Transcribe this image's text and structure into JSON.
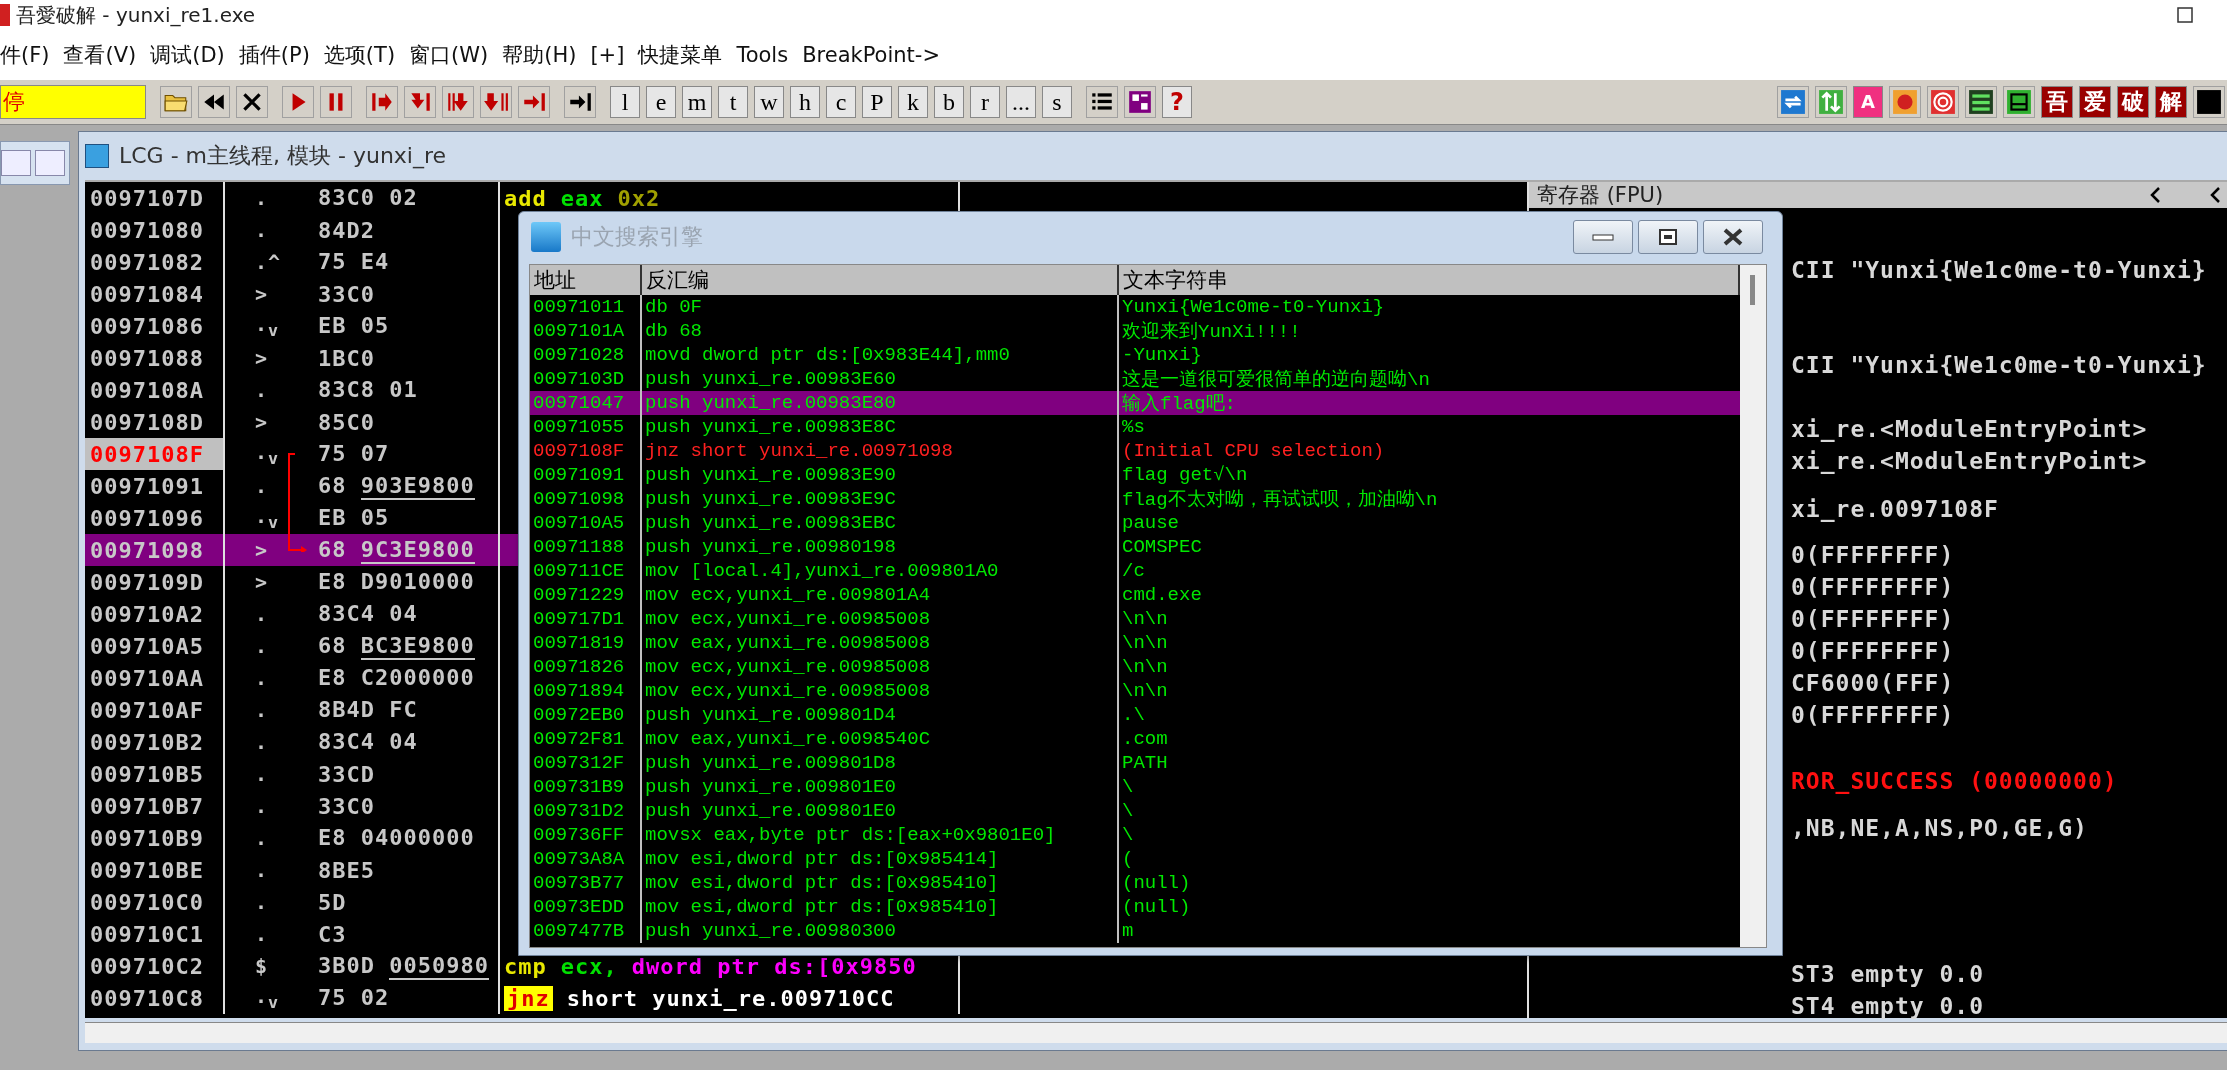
{
  "title_bar": {
    "title": "吾愛破解 - yunxi_re1.exe"
  },
  "menu": [
    "件(F)",
    "查看(V)",
    "调试(D)",
    "插件(P)",
    "选项(T)",
    "窗口(W)",
    "帮助(H)",
    "[+]",
    "快捷菜单",
    "Tools",
    "BreakPoint->"
  ],
  "toolbar": {
    "status": "停",
    "groups": [
      [
        {
          "kind": "open"
        },
        {
          "kind": "rewind"
        },
        {
          "kind": "close"
        }
      ],
      [
        {
          "kind": "run"
        },
        {
          "kind": "pause"
        }
      ],
      [
        {
          "kind": "step-into"
        },
        {
          "kind": "step-over"
        },
        {
          "kind": "trace-into"
        },
        {
          "kind": "trace-over"
        },
        {
          "kind": "till-return"
        }
      ],
      [
        {
          "kind": "goto"
        }
      ],
      [
        {
          "kind": "letter",
          "label": "l"
        },
        {
          "kind": "letter",
          "label": "e"
        },
        {
          "kind": "letter",
          "label": "m"
        },
        {
          "kind": "letter",
          "label": "t"
        },
        {
          "kind": "letter",
          "label": "w"
        },
        {
          "kind": "letter",
          "label": "h"
        },
        {
          "kind": "letter",
          "label": "c"
        },
        {
          "kind": "letter",
          "label": "P"
        },
        {
          "kind": "letter",
          "label": "k"
        },
        {
          "kind": "letter",
          "label": "b"
        },
        {
          "kind": "letter",
          "label": "r"
        },
        {
          "kind": "letter",
          "label": "..."
        },
        {
          "kind": "letter",
          "label": "s"
        }
      ],
      [
        {
          "kind": "list"
        },
        {
          "kind": "windows"
        },
        {
          "kind": "help",
          "label": "?"
        }
      ],
      [
        {
          "kind": "refresh"
        },
        {
          "kind": "swap"
        },
        {
          "kind": "tag-pink",
          "label": "A"
        },
        {
          "kind": "record"
        },
        {
          "kind": "target"
        },
        {
          "kind": "binary"
        },
        {
          "kind": "panel"
        },
        {
          "kind": "tag-red",
          "label": "吾"
        },
        {
          "kind": "tag-red",
          "label": "爱"
        },
        {
          "kind": "tag-red",
          "label": "破"
        },
        {
          "kind": "tag-red",
          "label": "解"
        },
        {
          "kind": "black"
        }
      ]
    ]
  },
  "cpu_window": {
    "title": "LCG - m主线程, 模块 - yunxi_re",
    "rows": [
      {
        "address": "0097107D",
        "flag": ".",
        "opcode": "83C0",
        "operand": "02",
        "underlined": false,
        "current": false,
        "selected": false,
        "asm": [
          {
            "text": "add",
            "kind": "cmd"
          },
          {
            "text": "eax",
            "kind": "reg"
          },
          {
            "text": "0x2",
            "kind": "num"
          }
        ]
      },
      {
        "address": "00971080",
        "flag": ".",
        "opcode": "84D2",
        "current": false,
        "selected": false
      },
      {
        "address": "00971082",
        "flag": ".^",
        "opcode": "75",
        "operand": "E4",
        "underlined": false,
        "current": false,
        "selected": false
      },
      {
        "address": "00971084",
        "flag": ">",
        "opcode": "33C0",
        "current": false,
        "selected": false
      },
      {
        "address": "00971086",
        "flag": ".$_{v}$",
        "opcode": "EB",
        "operand": "05",
        "underlined": false,
        "current": false,
        "selected": false
      },
      {
        "address": "00971088",
        "flag": ">",
        "opcode": "1BC0",
        "current": false,
        "selected": false
      },
      {
        "address": "0097108A",
        "flag": ".",
        "opcode": "83C8",
        "operand": "01",
        "underlined": false,
        "current": false,
        "selected": false
      },
      {
        "address": "0097108D",
        "flag": ">",
        "opcode": "85C0",
        "current": false,
        "selected": false
      },
      {
        "address": "0097108F",
        "flag": ".$_{v}$",
        "opcode": "75",
        "operand": "07",
        "underlined": false,
        "current": true,
        "selected": false,
        "jump_start": true
      },
      {
        "address": "00971091",
        "flag": ".",
        "opcode": "68",
        "operand": "903E9800",
        "underlined": true,
        "current": false,
        "selected": false
      },
      {
        "address": "00971096",
        "flag": ".$_{v}$",
        "opcode": "EB",
        "operand": "05",
        "underlined": false,
        "current": false,
        "selected": false
      },
      {
        "address": "00971098",
        "flag": ">",
        "opcode": "68",
        "operand": "9C3E9800",
        "underlined": true,
        "current": false,
        "selected": true,
        "jump_end": true
      },
      {
        "address": "0097109D",
        "flag": ">",
        "opcode": "E8",
        "operand": "D9010000",
        "underlined": false,
        "current": false,
        "selected": false
      },
      {
        "address": "009710A2",
        "flag": ".",
        "opcode": "83C4",
        "operand": "04",
        "underlined": false,
        "current": false,
        "selected": false
      },
      {
        "address": "009710A5",
        "flag": ".",
        "opcode": "68",
        "operand": "BC3E9800",
        "underlined": true,
        "current": false,
        "selected": false
      },
      {
        "address": "009710AA",
        "flag": ".",
        "opcode": "E8",
        "operand": "C2000000",
        "underlined": false,
        "current": false,
        "selected": false
      },
      {
        "address": "009710AF",
        "flag": ".",
        "opcode": "8B4D",
        "operand": "FC",
        "underlined": false,
        "current": false,
        "selected": false
      },
      {
        "address": "009710B2",
        "flag": ".",
        "opcode": "83C4",
        "operand": "04",
        "underlined": false,
        "current": false,
        "selected": false
      },
      {
        "address": "009710B5",
        "flag": ".",
        "opcode": "33CD",
        "current": false,
        "selected": false
      },
      {
        "address": "009710B7",
        "flag": ".",
        "opcode": "33C0",
        "current": false,
        "selected": false
      },
      {
        "address": "009710B9",
        "flag": ".",
        "opcode": "E8",
        "operand": "04000000",
        "underlined": false,
        "current": false,
        "selected": false
      },
      {
        "address": "009710BE",
        "flag": ".",
        "opcode": "8BE5",
        "current": false,
        "selected": false
      },
      {
        "address": "009710C0",
        "flag": ".",
        "opcode": "5D",
        "current": false,
        "selected": false
      },
      {
        "address": "009710C1",
        "flag": ".",
        "opcode": "C3",
        "current": false,
        "selected": false
      },
      {
        "address": "009710C2",
        "flag": "$",
        "opcode": "3B0D",
        "operand": "0050980",
        "underlined": true,
        "current": false,
        "selected": false,
        "asm": [
          {
            "text": "cmp",
            "kind": "cmd"
          },
          {
            "text": "ecx,",
            "kind": "reg"
          },
          {
            "text": "dword ptr ds:[0x9850",
            "kind": "mem"
          }
        ]
      },
      {
        "address": "009710C8",
        "flag": ".$_{v}$",
        "opcode": "75",
        "operand": "02",
        "underlined": false,
        "current": false,
        "selected": false,
        "asm": [
          {
            "text": "jnz",
            "kind": "jcc"
          },
          {
            "text": "short yunxi_re.009710CC",
            "kind": "plain"
          }
        ]
      }
    ],
    "registers": {
      "title": "寄存器 (FPU)",
      "groups": [
        [
          {
            "text": "CII \"Yunxi{We1c0me-t0-Yunxi}",
            "kind": "normal"
          }
        ],
        [
          {
            "text": "CII \"Yunxi{We1c0me-t0-Yunxi}",
            "kind": "normal"
          }
        ],
        [
          {
            "text": "xi_re.<ModuleEntryPoint>",
            "kind": "normal"
          },
          {
            "text": "xi_re.<ModuleEntryPoint>",
            "kind": "normal"
          }
        ],
        [
          {
            "text": "xi_re.0097108F",
            "kind": "normal"
          }
        ],
        [
          {
            "text": "0(FFFFFFFF)",
            "kind": "normal"
          },
          {
            "text": "0(FFFFFFFF)",
            "kind": "normal"
          },
          {
            "text": "0(FFFFFFFF)",
            "kind": "normal"
          },
          {
            "text": "0(FFFFFFFF)",
            "kind": "normal"
          },
          {
            "text": "CF6000(FFF)",
            "kind": "normal"
          },
          {
            "text": "0(FFFFFFFF)",
            "kind": "normal"
          }
        ],
        [
          {
            "text": "ROR_SUCCESS (00000000)",
            "kind": "error"
          }
        ],
        [
          {
            "text": ",NB,NE,A,NS,PO,GE,G)",
            "kind": "normal"
          }
        ],
        [
          {
            "text": "ST3 empty 0.0",
            "kind": "normal"
          },
          {
            "text": "ST4 empty 0.0",
            "kind": "normal"
          }
        ]
      ]
    }
  },
  "search_dialog": {
    "title": "中文搜索引擎",
    "columns": [
      "地址",
      "反汇编",
      "文本字符串"
    ],
    "rows": [
      {
        "address": "00971011",
        "disassembly": "db 0F",
        "text": "Yunxi{We1c0me-t0-Yunxi}",
        "selected": false,
        "current": false
      },
      {
        "address": "0097101A",
        "disassembly": "db 68",
        "text": "欢迎来到YunXi!!!!",
        "selected": false,
        "current": false
      },
      {
        "address": "00971028",
        "disassembly": "movd dword ptr ds:[0x983E44],mm0",
        "text": "-Yunxi}",
        "selected": false,
        "current": false
      },
      {
        "address": "0097103D",
        "disassembly": "push yunxi_re.00983E60",
        "text": "这是一道很可爱很简单的逆向题呦\\n",
        "selected": false,
        "current": false
      },
      {
        "address": "00971047",
        "disassembly": "push yunxi_re.00983E80",
        "text": "输入flag吧:",
        "selected": true,
        "current": false
      },
      {
        "address": "00971055",
        "disassembly": "push yunxi_re.00983E8C",
        "text": "%s",
        "selected": false,
        "current": false
      },
      {
        "address": "0097108F",
        "disassembly": "jnz short yunxi_re.00971098",
        "text": "(Initial CPU selection)",
        "selected": false,
        "current": true
      },
      {
        "address": "00971091",
        "disassembly": "push yunxi_re.00983E90",
        "text": "flag get√\\n",
        "selected": false,
        "current": false
      },
      {
        "address": "00971098",
        "disassembly": "push yunxi_re.00983E9C",
        "text": "flag不太对呦，再试试呗，加油呦\\n",
        "selected": false,
        "current": false
      },
      {
        "address": "009710A5",
        "disassembly": "push yunxi_re.00983EBC",
        "text": "pause",
        "selected": false,
        "current": false
      },
      {
        "address": "00971188",
        "disassembly": "push yunxi_re.00980198",
        "text": "COMSPEC",
        "selected": false,
        "current": false
      },
      {
        "address": "009711CE",
        "disassembly": "mov [local.4],yunxi_re.009801A0",
        "text": "/c",
        "selected": false,
        "current": false
      },
      {
        "address": "00971229",
        "disassembly": "mov ecx,yunxi_re.009801A4",
        "text": "cmd.exe",
        "selected": false,
        "current": false
      },
      {
        "address": "009717D1",
        "disassembly": "mov ecx,yunxi_re.00985008",
        "text": "\\n\\n",
        "selected": false,
        "current": false
      },
      {
        "address": "00971819",
        "disassembly": "mov eax,yunxi_re.00985008",
        "text": "\\n\\n",
        "selected": false,
        "current": false
      },
      {
        "address": "00971826",
        "disassembly": "mov ecx,yunxi_re.00985008",
        "text": "\\n\\n",
        "selected": false,
        "current": false
      },
      {
        "address": "00971894",
        "disassembly": "mov ecx,yunxi_re.00985008",
        "text": "\\n\\n",
        "selected": false,
        "current": false
      },
      {
        "address": "00972EB0",
        "disassembly": "push yunxi_re.009801D4",
        "text": ".\\",
        "selected": false,
        "current": false
      },
      {
        "address": "00972F81",
        "disassembly": "mov eax,yunxi_re.0098540C",
        "text": ".com",
        "selected": false,
        "current": false
      },
      {
        "address": "0097312F",
        "disassembly": "push yunxi_re.009801D8",
        "text": "PATH",
        "selected": false,
        "current": false
      },
      {
        "address": "009731B9",
        "disassembly": "push yunxi_re.009801E0",
        "text": "\\",
        "selected": false,
        "current": false
      },
      {
        "address": "009731D2",
        "disassembly": "push yunxi_re.009801E0",
        "text": "\\",
        "selected": false,
        "current": false
      },
      {
        "address": "009736FF",
        "disassembly": "movsx eax,byte ptr ds:[eax+0x9801E0]",
        "text": "\\",
        "selected": false,
        "current": false
      },
      {
        "address": "00973A8A",
        "disassembly": "mov esi,dword ptr ds:[0x985414]",
        "text": "(",
        "selected": false,
        "current": false
      },
      {
        "address": "00973B77",
        "disassembly": "mov esi,dword ptr ds:[0x985410]",
        "text": "(null)",
        "selected": false,
        "current": false
      },
      {
        "address": "00973EDD",
        "disassembly": "mov esi,dword ptr ds:[0x985410]",
        "text": "(null)",
        "selected": false,
        "current": false
      },
      {
        "address": "0097477B",
        "disassembly": "push yunxi_re.00980300",
        "text": "m",
        "selected": false,
        "current": false
      }
    ]
  }
}
